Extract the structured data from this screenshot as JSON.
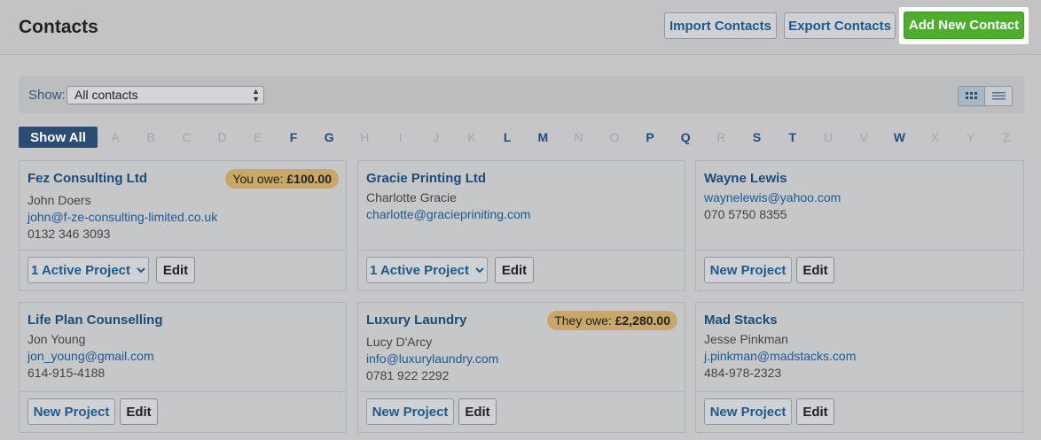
{
  "header": {
    "title": "Contacts",
    "import_label": "Import Contacts",
    "export_label": "Export Contacts",
    "add_label": "Add New Contact"
  },
  "filter": {
    "show_label": "Show:",
    "selected": "All contacts"
  },
  "alphabet": {
    "show_all": "Show All",
    "letters": [
      {
        "l": "A",
        "on": false
      },
      {
        "l": "B",
        "on": false
      },
      {
        "l": "C",
        "on": false
      },
      {
        "l": "D",
        "on": false
      },
      {
        "l": "E",
        "on": false
      },
      {
        "l": "F",
        "on": true
      },
      {
        "l": "G",
        "on": true
      },
      {
        "l": "H",
        "on": false
      },
      {
        "l": "I",
        "on": false
      },
      {
        "l": "J",
        "on": false
      },
      {
        "l": "K",
        "on": false
      },
      {
        "l": "L",
        "on": true
      },
      {
        "l": "M",
        "on": true
      },
      {
        "l": "N",
        "on": false
      },
      {
        "l": "O",
        "on": false
      },
      {
        "l": "P",
        "on": true
      },
      {
        "l": "Q",
        "on": true
      },
      {
        "l": "R",
        "on": false
      },
      {
        "l": "S",
        "on": true
      },
      {
        "l": "T",
        "on": true
      },
      {
        "l": "U",
        "on": false
      },
      {
        "l": "V",
        "on": false
      },
      {
        "l": "W",
        "on": true
      },
      {
        "l": "X",
        "on": false
      },
      {
        "l": "Y",
        "on": false
      },
      {
        "l": "Z",
        "on": false
      }
    ]
  },
  "labels": {
    "active_project": "1 Active Project",
    "new_project": "New Project",
    "edit": "Edit"
  },
  "contacts": [
    {
      "name": "Fez Consulting Ltd",
      "person": "John Doers",
      "email": "john@f-ze-consulting-limited.co.uk",
      "phone": "0132 346 3093",
      "badge_label": "You owe:",
      "badge_amount": "£100.00",
      "project": "1 Active Project"
    },
    {
      "name": "Gracie Printing Ltd",
      "person": "Charlotte Gracie",
      "email": "charlotte@graciepriniting.com",
      "phone": "",
      "badge_label": "",
      "badge_amount": "",
      "project": "1 Active Project"
    },
    {
      "name": "Wayne Lewis",
      "person": "",
      "email": "waynelewis@yahoo.com",
      "phone": "070 5750 8355",
      "badge_label": "",
      "badge_amount": "",
      "project": "New Project"
    },
    {
      "name": "Life Plan Counselling",
      "person": "Jon Young",
      "email": "jon_young@gmail.com",
      "phone": "614-915-4188",
      "badge_label": "",
      "badge_amount": "",
      "project": "New Project"
    },
    {
      "name": "Luxury Laundry",
      "person": "Lucy D'Arcy",
      "email": "info@luxurylaundry.com",
      "phone": "0781 922 2292",
      "badge_label": "They owe:",
      "badge_amount": "£2,280.00",
      "project": "New Project"
    },
    {
      "name": "Mad Stacks",
      "person": "Jesse Pinkman",
      "email": "j.pinkman@madstacks.com",
      "phone": "484-978-2323",
      "badge_label": "",
      "badge_amount": "",
      "project": "New Project"
    }
  ]
}
